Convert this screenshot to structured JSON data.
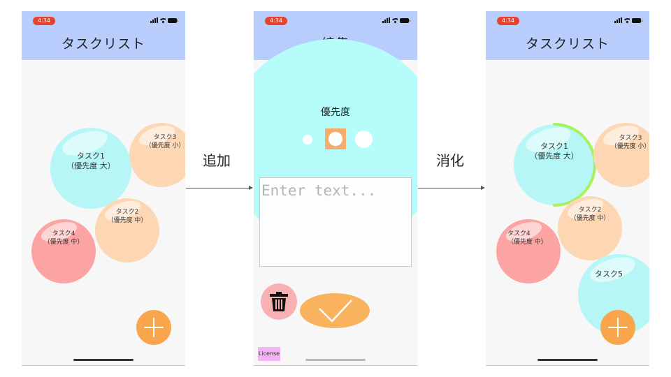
{
  "status_time": "4:34",
  "screens": {
    "list_before": {
      "title": "タスクリスト",
      "tasks": [
        {
          "name": "タスク1",
          "priority": "（優先度 大）"
        },
        {
          "name": "タスク3",
          "priority": "（優先度 小）"
        },
        {
          "name": "タスク2",
          "priority": "（優先度 中）"
        },
        {
          "name": "タスク4",
          "priority": "（優先度 中）"
        }
      ]
    },
    "edit": {
      "title": "編集",
      "priority_label": "優先度",
      "input_placeholder": "Enter text...",
      "license_label": "License"
    },
    "list_after": {
      "title": "タスクリスト",
      "task1_progress": 0.5,
      "tasks": [
        {
          "name": "タスク1",
          "priority": "（優先度 大）"
        },
        {
          "name": "タスク3",
          "priority": "（優先度 小）"
        },
        {
          "name": "タスク2",
          "priority": "（優先度 中）"
        },
        {
          "name": "タスク4",
          "priority": "（優先度 中）"
        },
        {
          "name": "タスク5"
        }
      ]
    }
  },
  "flow": {
    "add_label": "追加",
    "complete_label": "消化"
  },
  "colors": {
    "header": "#b8cdfb",
    "bubble_high": "#b6f6f7",
    "bubble_mid_low": "#fdd7b4",
    "bubble_alt": "#fca3a3",
    "fab": "#f9a54c",
    "progress_ring": "#a4f25e"
  },
  "icons": [
    "plus-icon",
    "trash-icon",
    "checkmark-icon",
    "signal-icon",
    "wifi-icon",
    "battery-icon"
  ]
}
